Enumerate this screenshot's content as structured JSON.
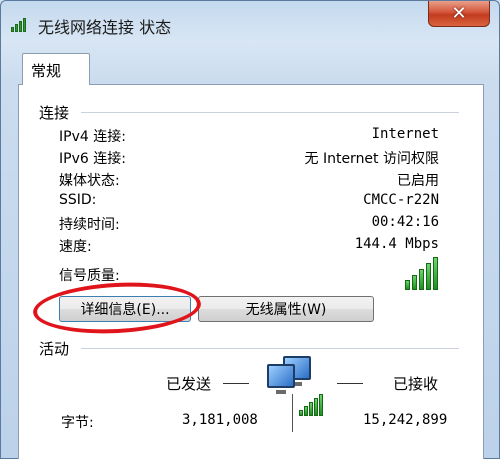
{
  "window": {
    "title": "无线网络连接 状态",
    "close_symbol": "✕"
  },
  "tabs": [
    {
      "label": "常规"
    }
  ],
  "connection": {
    "section_label": "连接",
    "rows": [
      {
        "label": "IPv4 连接:",
        "value": "Internet"
      },
      {
        "label": "IPv6 连接:",
        "value": "无 Internet 访问权限"
      },
      {
        "label": "媒体状态:",
        "value": "已启用"
      },
      {
        "label": "SSID:",
        "value": "CMCC-r22N"
      },
      {
        "label": "持续时间:",
        "value": "00:42:16"
      },
      {
        "label": "速度:",
        "value": "144.4 Mbps"
      }
    ],
    "signal_label": "信号质量:",
    "signal_bars": 5
  },
  "buttons": {
    "details": "详细信息(E)...",
    "wireless_properties": "无线属性(W)"
  },
  "activity": {
    "section_label": "活动",
    "sent_label": "已发送",
    "received_label": "已接收",
    "bytes_label": "字节:",
    "bytes_sent": "3,181,008",
    "bytes_received": "15,242,899"
  },
  "colors": {
    "annotation_circle": "#e0141b",
    "signal_green": "#2f9a2f",
    "close_red": "#c23b1f"
  },
  "icons": {
    "title": "wireless-signal-icon",
    "activity": "network-computers-icon"
  }
}
